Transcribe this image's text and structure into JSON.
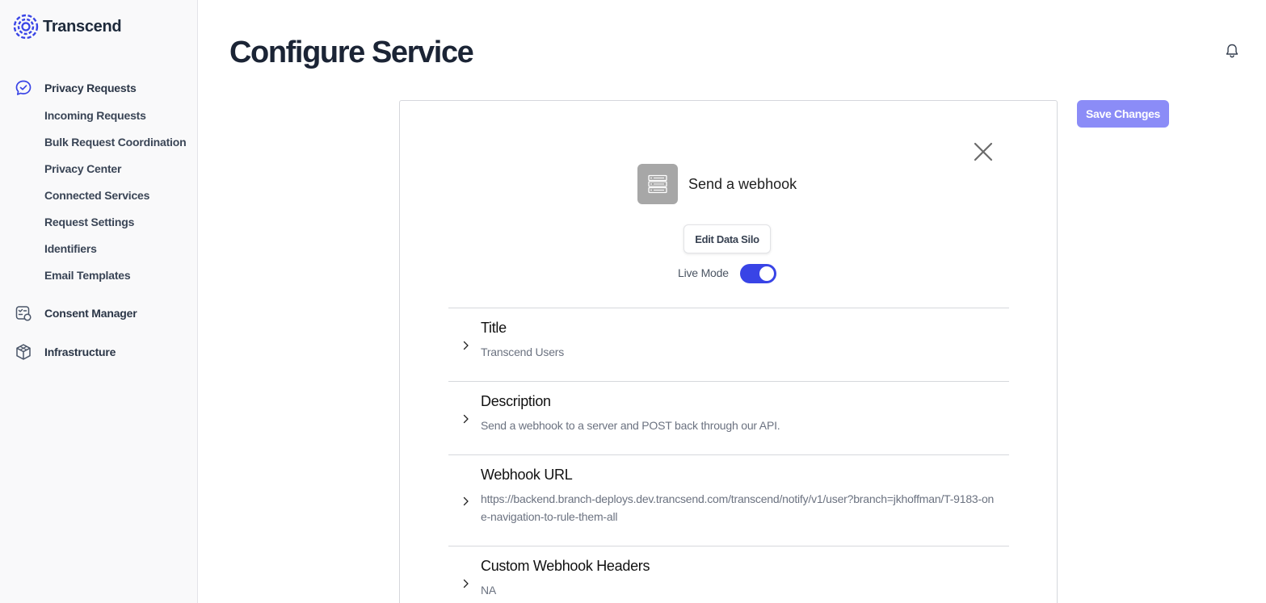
{
  "app": {
    "brand": "Transcend"
  },
  "sidebar": {
    "sections": [
      {
        "label": "Privacy Requests",
        "icon": "chat-check-icon",
        "items": [
          {
            "label": "Incoming Requests"
          },
          {
            "label": "Bulk Request Coordination"
          },
          {
            "label": "Privacy Center"
          },
          {
            "label": "Connected Services"
          },
          {
            "label": "Request Settings"
          },
          {
            "label": "Identifiers"
          },
          {
            "label": "Email Templates"
          }
        ]
      },
      {
        "label": "Consent Manager",
        "icon": "consent-icon"
      },
      {
        "label": "Infrastructure",
        "icon": "cube-icon"
      }
    ]
  },
  "header": {
    "title": "Configure Service",
    "bell_icon": "bell-icon"
  },
  "toolbar": {
    "save_label": "Save Changes",
    "save_color": "#8b8cf7"
  },
  "card": {
    "silo_name": "Send a webhook",
    "silo_icon": "server-icon",
    "edit_label": "Edit Data Silo",
    "live_mode_label": "Live Mode",
    "live_mode_on": true,
    "toggle_color": "#3944e6",
    "fields": [
      {
        "label": "Title",
        "value": "Transcend Users"
      },
      {
        "label": "Description",
        "value": "Send a webhook to a server and POST back through our API."
      },
      {
        "label": "Webhook URL",
        "value": "https://backend.branch-deploys.dev.trancsend.com/transcend/notify/v1/user?branch=jkhoffman/T-9183-one-navigation-to-rule-them-all"
      },
      {
        "label": "Custom Webhook Headers",
        "value": "NA"
      }
    ]
  }
}
